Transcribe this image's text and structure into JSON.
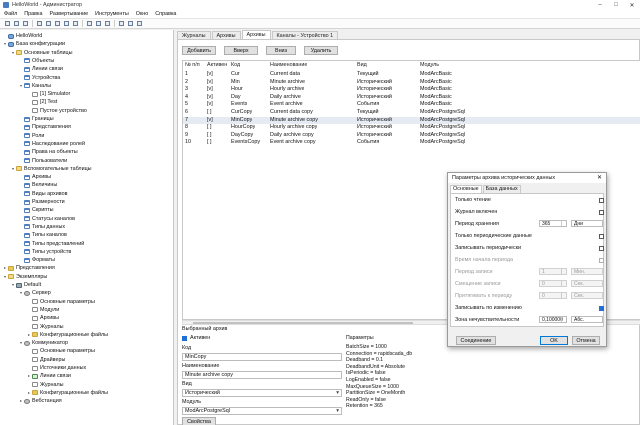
{
  "window": {
    "title": "HelloWorld - Администратор"
  },
  "menu": [
    "Файл",
    "Правка",
    "Развертывание",
    "Инструменты",
    "Окно",
    "Справка"
  ],
  "toolbar": {
    "icons": [
      "new-icon",
      "open-icon",
      "save-icon",
      "save-all-icon",
      "cut-icon",
      "copy-icon",
      "paste-icon",
      "undo-icon",
      "redo-icon",
      "find-icon",
      "upload-icon",
      "download-icon",
      "settings-icon",
      "help-icon"
    ]
  },
  "tree": [
    {
      "label": "HelloWorld",
      "icon": "project",
      "level": 0,
      "expander": ""
    },
    {
      "label": "База конфигурации",
      "icon": "db",
      "level": 0,
      "expander": "▾"
    },
    {
      "label": "Основные таблицы",
      "icon": "folder-open",
      "level": 1,
      "expander": "▾"
    },
    {
      "label": "Объекты",
      "icon": "table",
      "level": 2,
      "expander": ""
    },
    {
      "label": "Линии связи",
      "icon": "table",
      "level": 2,
      "expander": ""
    },
    {
      "label": "Устройства",
      "icon": "table",
      "level": 2,
      "expander": ""
    },
    {
      "label": "Каналы",
      "icon": "table",
      "level": 2,
      "expander": "▾"
    },
    {
      "label": "[1] Simulator",
      "icon": "page",
      "level": 3,
      "expander": ""
    },
    {
      "label": "[2] Test",
      "icon": "page",
      "level": 3,
      "expander": ""
    },
    {
      "label": "Пустое устройство",
      "icon": "page",
      "level": 3,
      "expander": ""
    },
    {
      "label": "Границы",
      "icon": "table",
      "level": 2,
      "expander": ""
    },
    {
      "label": "Представления",
      "icon": "table",
      "level": 2,
      "expander": ""
    },
    {
      "label": "Роли",
      "icon": "table",
      "level": 2,
      "expander": ""
    },
    {
      "label": "Наследование ролей",
      "icon": "table",
      "level": 2,
      "expander": ""
    },
    {
      "label": "Права на объекты",
      "icon": "table",
      "level": 2,
      "expander": ""
    },
    {
      "label": "Пользователи",
      "icon": "table",
      "level": 2,
      "expander": ""
    },
    {
      "label": "Вспомогательные таблицы",
      "icon": "folder-open",
      "level": 1,
      "expander": "▾"
    },
    {
      "label": "Архивы",
      "icon": "table",
      "level": 2,
      "expander": ""
    },
    {
      "label": "Величины",
      "icon": "table",
      "level": 2,
      "expander": ""
    },
    {
      "label": "Виды архивов",
      "icon": "table",
      "level": 2,
      "expander": ""
    },
    {
      "label": "Размерности",
      "icon": "table",
      "level": 2,
      "expander": ""
    },
    {
      "label": "Скрипты",
      "icon": "table",
      "level": 2,
      "expander": ""
    },
    {
      "label": "Статусы каналов",
      "icon": "table",
      "level": 2,
      "expander": ""
    },
    {
      "label": "Типы данных",
      "icon": "table",
      "level": 2,
      "expander": ""
    },
    {
      "label": "Типы каналов",
      "icon": "table",
      "level": 2,
      "expander": ""
    },
    {
      "label": "Типы представлений",
      "icon": "table",
      "level": 2,
      "expander": ""
    },
    {
      "label": "Типы устройств",
      "icon": "table",
      "level": 2,
      "expander": ""
    },
    {
      "label": "Форматы",
      "icon": "table",
      "level": 2,
      "expander": ""
    },
    {
      "label": "Представления",
      "icon": "folder",
      "level": 0,
      "expander": "▸"
    },
    {
      "label": "Экземпляры",
      "icon": "folder-open",
      "level": 0,
      "expander": "▾"
    },
    {
      "label": "Default",
      "icon": "server",
      "level": 1,
      "expander": "▾"
    },
    {
      "label": "Сервер",
      "icon": "gear",
      "level": 2,
      "expander": "▾"
    },
    {
      "label": "Основные параметры",
      "icon": "page",
      "level": 3,
      "expander": ""
    },
    {
      "label": "Модули",
      "icon": "page",
      "level": 3,
      "expander": ""
    },
    {
      "label": "Архивы",
      "icon": "page",
      "level": 3,
      "expander": ""
    },
    {
      "label": "Журналы",
      "icon": "page",
      "level": 3,
      "expander": ""
    },
    {
      "label": "Конфигурационные файлы",
      "icon": "folder",
      "level": 3,
      "expander": "▸"
    },
    {
      "label": "Коммуникатор",
      "icon": "gear",
      "level": 2,
      "expander": "▾"
    },
    {
      "label": "Основные параметры",
      "icon": "page",
      "level": 3,
      "expander": ""
    },
    {
      "label": "Драйверы",
      "icon": "page",
      "level": 3,
      "expander": ""
    },
    {
      "label": "Источники данных",
      "icon": "page",
      "level": 3,
      "expander": ""
    },
    {
      "label": "Линии связи",
      "icon": "link",
      "level": 3,
      "expander": "▸"
    },
    {
      "label": "Журналы",
      "icon": "page",
      "level": 3,
      "expander": ""
    },
    {
      "label": "Конфигурационные файлы",
      "icon": "folder",
      "level": 3,
      "expander": "▸"
    },
    {
      "label": "Вебстанция",
      "icon": "gear",
      "level": 2,
      "expander": "▸"
    }
  ],
  "tabs": [
    "Журналы",
    "Архивы",
    "Архивы",
    "Каналы - Устройство 1"
  ],
  "active_tab": 2,
  "buttons": {
    "add": "Добавить",
    "up": "Вверх",
    "down": "Вниз",
    "delete": "Удалить"
  },
  "grid": {
    "headers": [
      "№ п/п",
      "Активен",
      "Код",
      "Наименование",
      "Вид",
      "Модуль"
    ],
    "rows": [
      [
        "1",
        "[v]",
        "Cur",
        "Current data",
        "Текущий",
        "ModArcBasic"
      ],
      [
        "2",
        "[v]",
        "Min",
        "Minute archive",
        "Исторический",
        "ModArcBasic"
      ],
      [
        "3",
        "[v]",
        "Hour",
        "Hourly archive",
        "Исторический",
        "ModArcBasic"
      ],
      [
        "4",
        "[v]",
        "Day",
        "Daily archive",
        "Исторический",
        "ModArcBasic"
      ],
      [
        "5",
        "[v]",
        "Events",
        "Event archive",
        "События",
        "ModArcBasic"
      ],
      [
        "6",
        "[ ]",
        "CurCopy",
        "Current data copy",
        "Текущий",
        "ModArcPostgreSql"
      ],
      [
        "7",
        "[v]",
        "MinCopy",
        "Minute archive copy",
        "Исторический",
        "ModArcPostgreSql"
      ],
      [
        "8",
        "[ ]",
        "HourCopy",
        "Hourly archive copy",
        "Исторический",
        "ModArcPostgreSql"
      ],
      [
        "9",
        "[ ]",
        "DayCopy",
        "Daily archive copy",
        "Исторический",
        "ModArcPostgreSql"
      ],
      [
        "10",
        "[ ]",
        "EventsCopy",
        "Event archive copy",
        "События",
        "ModArcPostgreSql"
      ]
    ],
    "selected_row": 6
  },
  "selected": {
    "group_title": "Выбранный архив",
    "active_label": "Активен",
    "code_label": "Код",
    "code_value": "MinCopy",
    "name_label": "Наименование",
    "name_value": "Minute archive copy",
    "kind_label": "Вид",
    "kind_value": "Исторический",
    "module_label": "Модуль",
    "module_value": "ModArcPostgreSql",
    "props_button": "Свойства"
  },
  "params": {
    "title": "Параметры",
    "lines": [
      "BatchSize = 1000",
      "Connection = rapidscada_db",
      "Deadband = 0.1",
      "DeadbandUnit = Absolute",
      "IsPeriodic = false",
      "LogEnabled = false",
      "MaxQueueSize = 1000",
      "PartitionSize = OneMonth",
      "ReadOnly = false",
      "Retention = 365"
    ]
  },
  "dialog": {
    "title": "Параметры архива исторических данных",
    "close": "✕",
    "tabs": [
      "Основные",
      "База данных"
    ],
    "rows": [
      {
        "label": "Только чтение",
        "checked": false,
        "disabled": false
      },
      {
        "label": "Журнал включен",
        "checked": false,
        "disabled": false
      },
      {
        "label": "Период хранения",
        "value": "365",
        "unit": "Дни",
        "disabled": false
      },
      {
        "label": "Только периодические данные",
        "checked": false,
        "disabled": false
      },
      {
        "label": "Записывать периодически",
        "checked": false,
        "disabled": false
      },
      {
        "label": "Время начала периода",
        "checked": false,
        "disabled": true
      },
      {
        "label": "Период записи",
        "value": "1",
        "unit": "Мин.",
        "disabled": true
      },
      {
        "label": "Смещение записи",
        "value": "0",
        "unit": "Сек.",
        "disabled": true
      },
      {
        "label": "Притягивать к периоду",
        "value": "0",
        "unit": "Сек.",
        "disabled": true
      },
      {
        "label": "Записывать по изменению",
        "checked": true,
        "disabled": false
      },
      {
        "label": "Зона нечувствительности",
        "value": "0,100000",
        "unit": "Абс.",
        "disabled": false
      }
    ],
    "buttons": {
      "connection": "Соединение",
      "ok": "OK",
      "cancel": "Отмена"
    }
  }
}
